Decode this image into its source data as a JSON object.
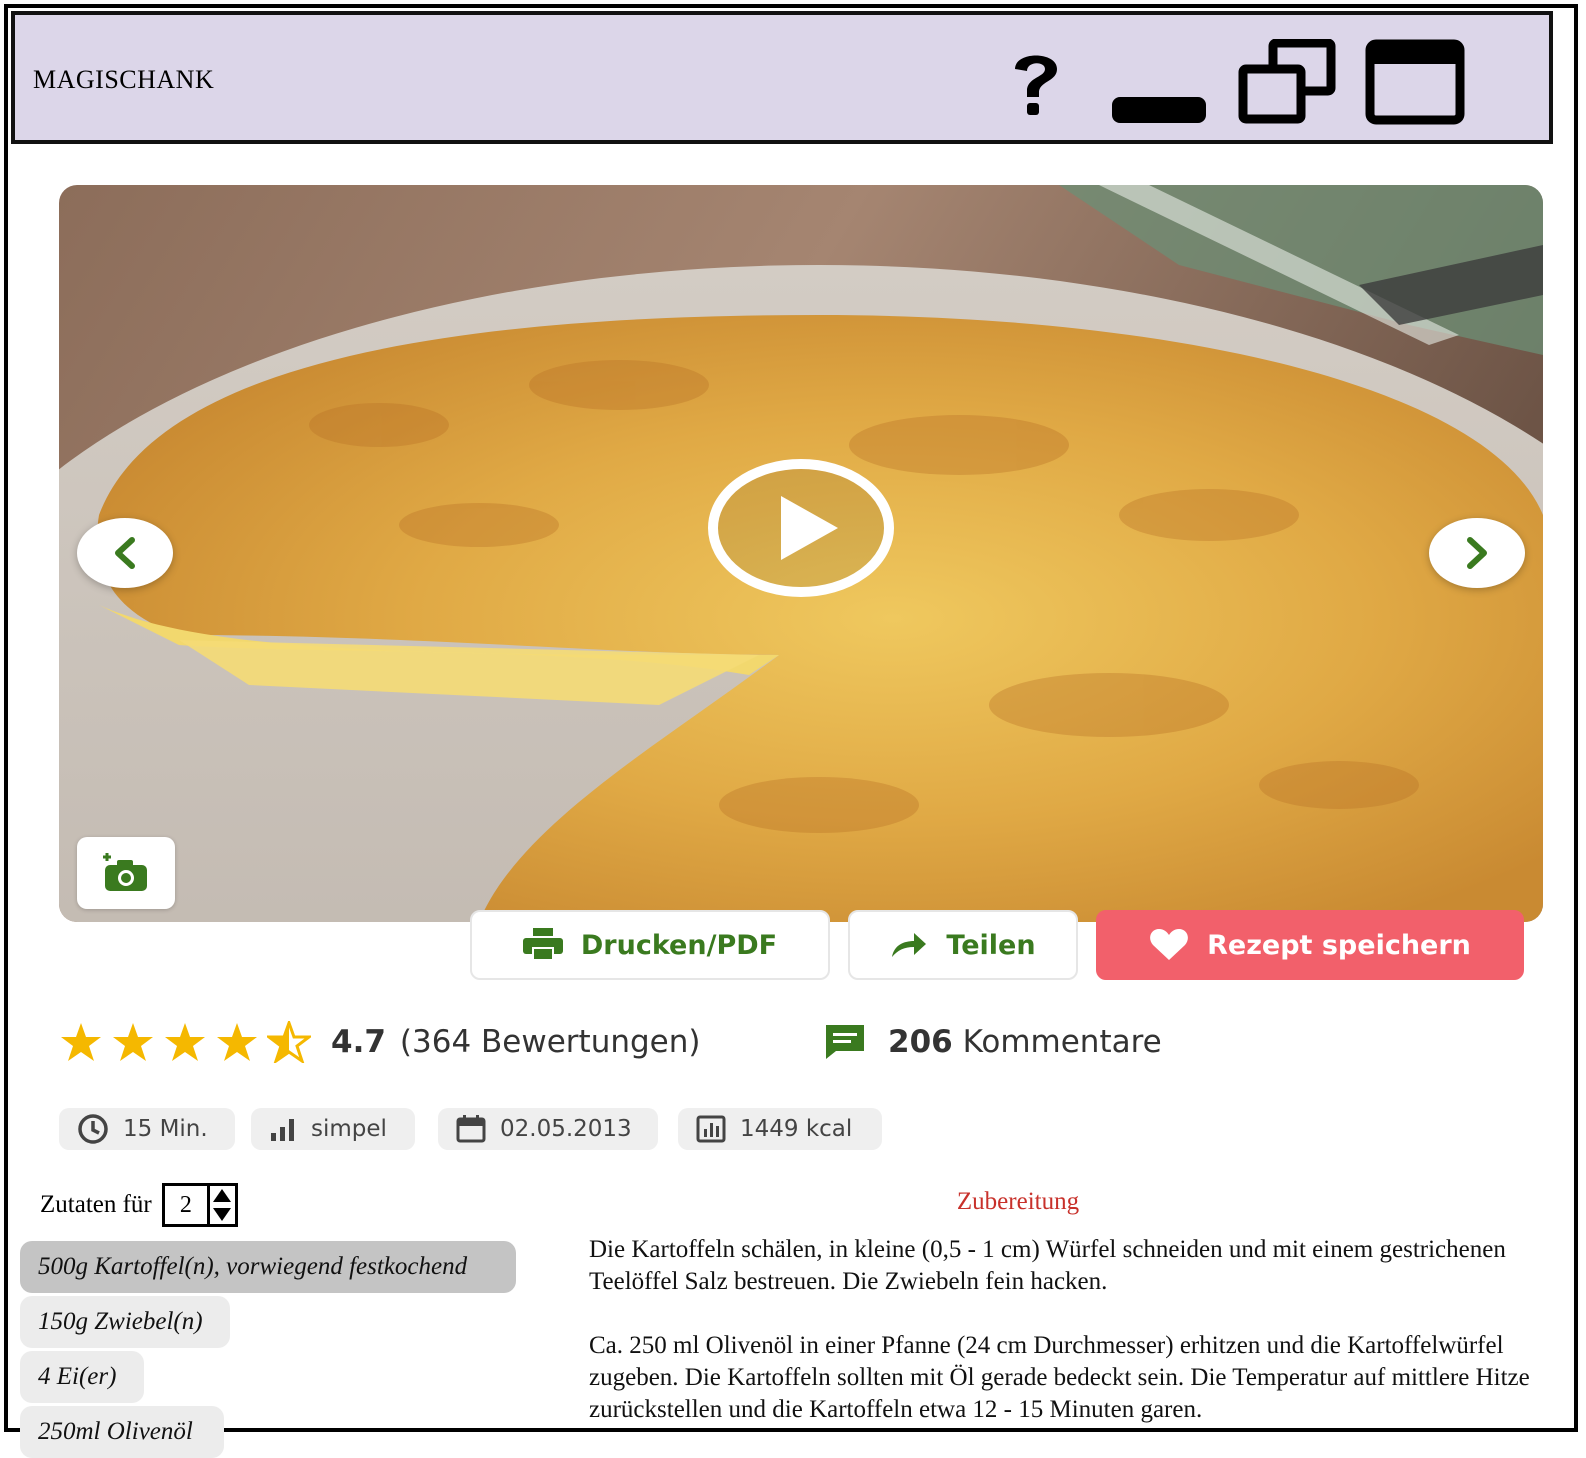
{
  "window": {
    "title": "MAGISCHANK",
    "controls": [
      "help-icon",
      "minimize-icon",
      "restore-icon",
      "maximize-icon"
    ]
  },
  "hero": {
    "nav_prev_icon": "chevron-left-icon",
    "nav_next_icon": "chevron-right-icon",
    "play_icon": "play-icon",
    "camera_icon": "camera-plus-icon"
  },
  "actions": {
    "print_label": "Drucken/PDF",
    "share_label": "Teilen",
    "save_label": "Rezept speichern"
  },
  "rating": {
    "stars": 4.5,
    "value": "4.7",
    "count_text": "(364 Bewertungen)"
  },
  "comments": {
    "count": "206",
    "label": "Kommentare"
  },
  "meta": {
    "time": "15 Min.",
    "difficulty": "simpel",
    "date": "02.05.2013",
    "calories": "1449 kcal"
  },
  "ingredients": {
    "label": "Zutaten für",
    "servings": "2",
    "items": [
      "500g Kartoffel(n), vorwiegend festkochend",
      "150g Zwiebel(n)",
      "4 Ei(er)",
      "250ml Olivenöl"
    ]
  },
  "preparation": {
    "title": "Zubereitung",
    "paragraphs": [
      "Die Kartoffeln schälen, in kleine (0,5 - 1 cm) Würfel schneiden und mit einem gestrichenen Teelöffel Salz bestreuen. Die Zwiebeln fein hacken.",
      "Ca. 250 ml Olivenöl in einer Pfanne (24 cm Durchmesser) erhitzen und die Kartoffelwürfel zugeben. Die Kartoffeln sollten mit Öl gerade bedeckt sein. Die Temperatur auf mittlere Hitze zurückstellen und die Kartoffeln etwa 12 - 15 Minuten garen."
    ]
  },
  "colors": {
    "titlebar": "#dcd6e9",
    "accent_green": "#3a7a1f",
    "save_button": "#f2606b",
    "star": "#f5b800",
    "heading_red": "#c8312b"
  }
}
